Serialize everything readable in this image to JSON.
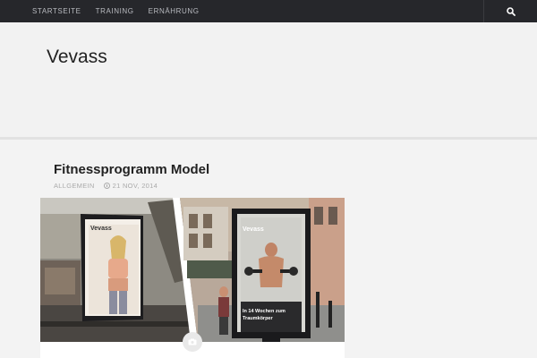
{
  "nav": {
    "items": [
      {
        "label": "STARTSEITE"
      },
      {
        "label": "TRAINING"
      },
      {
        "label": "ERNÄHRUNG"
      }
    ],
    "search_icon": "search-icon"
  },
  "site": {
    "title": "Vevass"
  },
  "post": {
    "title": "Fitnessprogramm Model",
    "category": "ALLGEMEIN",
    "date": "21 NOV, 2014",
    "image": {
      "left_poster_brand": "Vevass",
      "right_poster_brand": "Vevass",
      "right_poster_caption_line1": "In 14 Wochen zum",
      "right_poster_caption_line2": "Traumkörper"
    },
    "format_icon": "camera-icon"
  },
  "colors": {
    "topbar": "#26272b",
    "nav_text": "#b9bbc0",
    "background": "#f1f1f1",
    "title": "#222222",
    "meta": "#aaaaaa"
  }
}
